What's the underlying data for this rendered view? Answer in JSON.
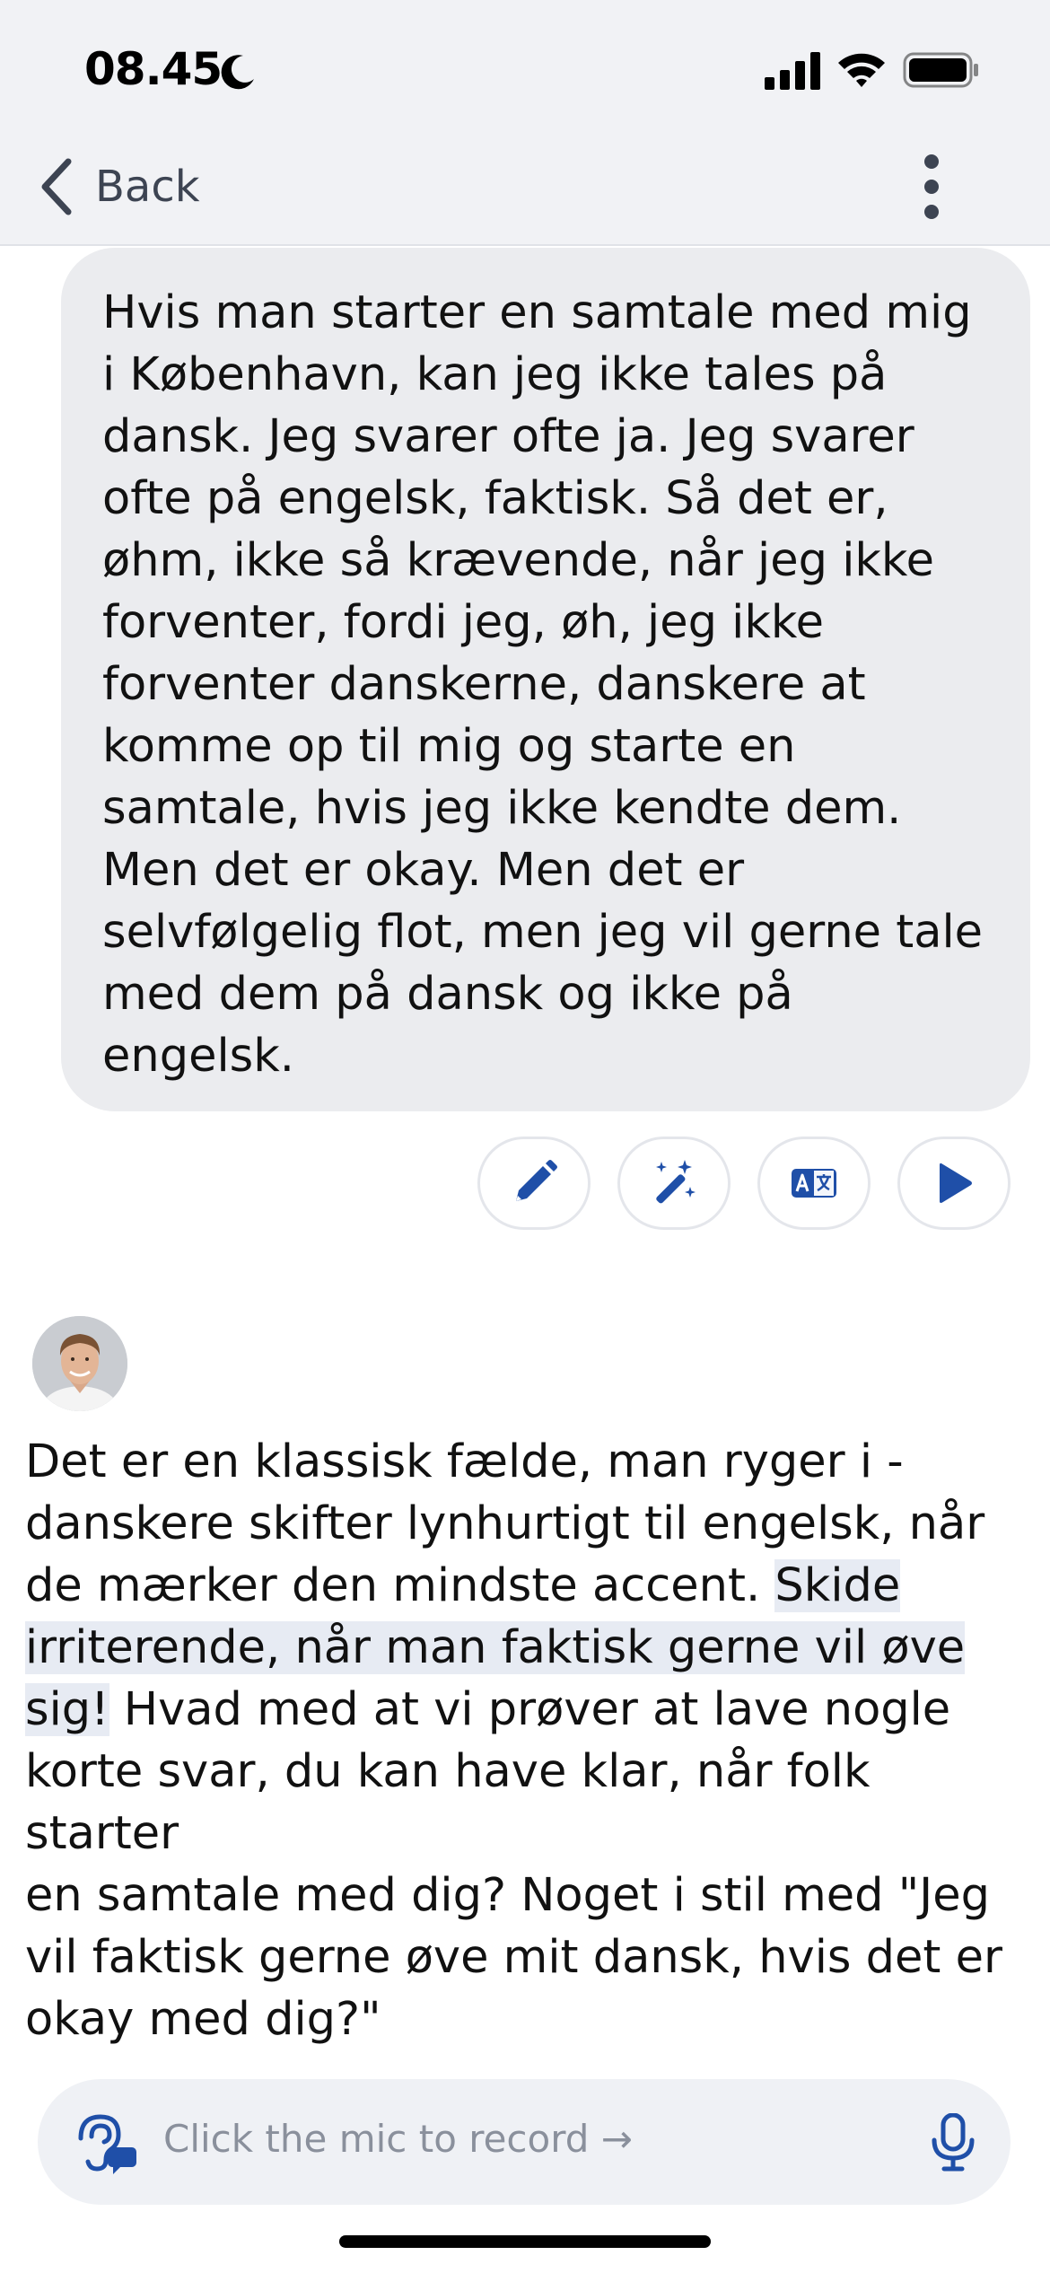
{
  "status_bar": {
    "time": "08.45",
    "icons": [
      "moon-icon",
      "signal-icon",
      "wifi-icon",
      "battery-icon"
    ]
  },
  "nav": {
    "back_label": "Back",
    "back_icon": "chevron-left-icon",
    "menu_icon": "more-vertical-icon"
  },
  "user_message": {
    "lines": [
      "Hvis man starter en samtale med mig",
      "i København, kan jeg ikke tales på",
      "dansk. Jeg svarer ofte ja. Jeg svarer",
      "ofte på engelsk, faktisk. Så det er,",
      "øhm, ikke så krævende, når jeg ikke",
      "forventer, fordi jeg, øh, jeg ikke",
      "forventer danskerne, danskere at",
      "komme op til mig og starte en",
      "samtale, hvis jeg ikke kendte dem.",
      "Men det er okay. Men det er",
      "selvfølgelig flot, men jeg vil gerne tale",
      "med dem på dansk og ikke på",
      "engelsk."
    ]
  },
  "message_actions": [
    {
      "name": "edit-button",
      "icon": "pencil-icon"
    },
    {
      "name": "improve-button",
      "icon": "magic-wand-icon"
    },
    {
      "name": "translate-button",
      "icon": "translate-icon"
    },
    {
      "name": "play-button",
      "icon": "play-icon"
    }
  ],
  "bot_message": {
    "avatar_icon": "tutor-avatar",
    "lines": [
      {
        "before": "Det er en klassisk fælde, man ryger i -",
        "highlight": "",
        "after": ""
      },
      {
        "before": "danskere skifter lynhurtigt til engelsk, når",
        "highlight": "",
        "after": ""
      },
      {
        "before": "de mærker den mindste accent. ",
        "highlight": "Skide",
        "after": ""
      },
      {
        "before": "",
        "highlight": "irriterende, når man faktisk gerne vil øve",
        "after": ""
      },
      {
        "before": "",
        "highlight": "sig!",
        "after": " Hvad med at vi prøver at lave nogle"
      },
      {
        "before": "korte svar, du kan have klar, når folk starter",
        "highlight": "",
        "after": ""
      },
      {
        "before": "en samtale med dig? Noget i stil med \"Jeg",
        "highlight": "",
        "after": ""
      },
      {
        "before": "vil faktisk gerne øve mit dansk, hvis det er",
        "highlight": "",
        "after": ""
      },
      {
        "before": "okay med dig?\"",
        "highlight": "",
        "after": ""
      }
    ]
  },
  "input": {
    "placeholder": "Click the mic to record →",
    "left_icon": "ear-listening-icon",
    "mic_icon": "microphone-icon"
  },
  "colors": {
    "accent": "#1f4fa8",
    "header_bg": "#f1f2f5",
    "bubble_bg": "#ebecef",
    "highlight_bg": "#e7ebf3"
  }
}
